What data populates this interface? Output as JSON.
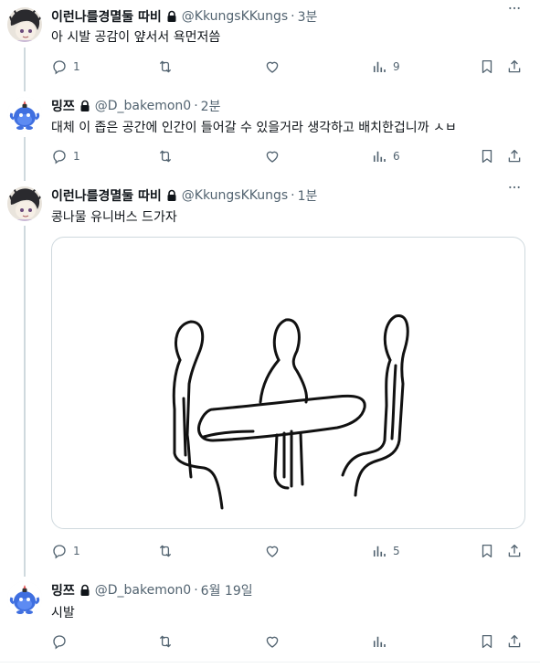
{
  "tweets": [
    {
      "name": "이런나를경멸둘 따비",
      "handle": "@KkungsKKungs",
      "time": "3분",
      "text": "아 시발 공감이 얖서서 욕먼저씀",
      "replies": "1",
      "retweets": "",
      "likes": "",
      "views": "9"
    },
    {
      "name": "밍쯔",
      "handle": "@D_bakemon0",
      "time": "2분",
      "text": "대체 이 좁은 공간에 인간이 들어갈 수 있을거라 생각하고 배치한겁니까 ㅅㅂ",
      "replies": "1",
      "retweets": "",
      "likes": "",
      "views": "6"
    },
    {
      "name": "이런나를경멸둘 따비",
      "handle": "@KkungsKKungs",
      "time": "1분",
      "text": "콩나물 유니버스 드가자",
      "replies": "1",
      "retweets": "",
      "likes": "",
      "views": "5"
    },
    {
      "name": "밍쯔",
      "handle": "@D_bakemon0",
      "time": "6월 19일",
      "text": "시발",
      "replies": "",
      "retweets": "",
      "likes": "",
      "views": ""
    }
  ],
  "separator": "·",
  "icons": {
    "reply": "reply-icon",
    "retweet": "retweet-icon",
    "like": "heart-icon",
    "views": "views-chart-icon",
    "bookmark": "bookmark-icon",
    "share": "share-icon",
    "more": "more-dots-icon",
    "lock": "lock-icon"
  },
  "colors": {
    "text": "#0f1419",
    "muted": "#536471",
    "line": "#cfd9de",
    "border": "#eff3f4"
  }
}
